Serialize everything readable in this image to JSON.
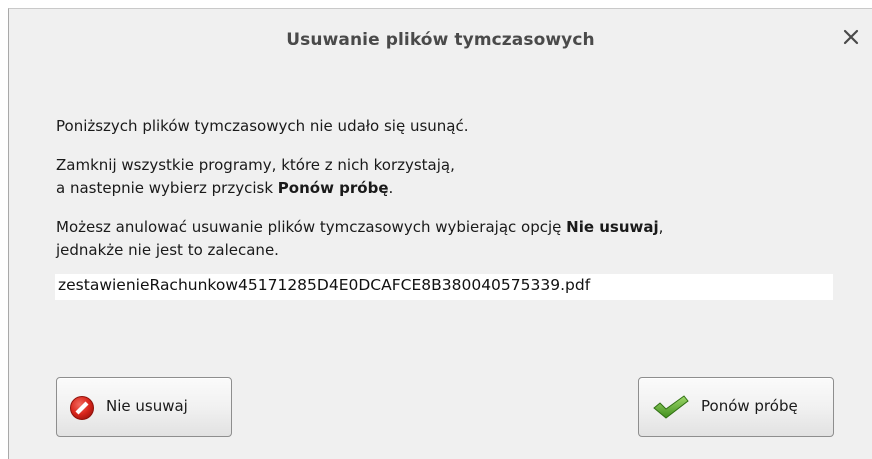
{
  "dialog": {
    "title": "Usuwanie plików tymczasowych",
    "close_icon": "close-icon"
  },
  "message": {
    "line1": "Poniższych plików tymczasowych nie udało się usunąć.",
    "line2": "Zamknij wszystkie programy, które z nich korzystają,",
    "line3_prefix": "a nastepnie wybierz przycisk ",
    "line3_bold": "Ponów próbę",
    "line3_suffix": ".",
    "line4_prefix": "Możesz anulować usuwanie plików tymczasowych wybierając opcję ",
    "line4_bold": "Nie usuwaj",
    "line4_suffix": ",",
    "line5": "jednakże nie jest to zalecane."
  },
  "files": [
    "zestawienieRachunkow45171285D4E0DCAFCE8B380040575339.pdf"
  ],
  "buttons": {
    "dont_delete": {
      "label": "Nie usuwaj",
      "icon": "no-entry-icon"
    },
    "retry": {
      "label": "Ponów próbę",
      "icon": "checkmark-icon"
    }
  },
  "colors": {
    "dialog_bg": "#f0f0f0",
    "no_entry": "#d9261c",
    "checkmark": "#5bab2a"
  }
}
